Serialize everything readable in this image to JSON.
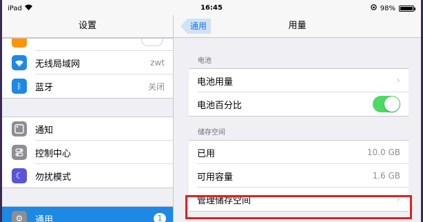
{
  "status_bar": {
    "device": "iPad",
    "time": "16:45",
    "battery": "98%",
    "battery_level": 0.98
  },
  "left": {
    "title": "设置",
    "group1": [
      {
        "label": "无线局域网",
        "detail": "zwt",
        "icon": "wifi-icon",
        "color": "#1e88e5"
      },
      {
        "label": "蓝牙",
        "detail": "关闭",
        "icon": "bluetooth-icon",
        "color": "#1e88e5"
      }
    ],
    "group2": [
      {
        "label": "通知",
        "icon": "notification-icon",
        "color": "#8e8e93"
      },
      {
        "label": "控制中心",
        "icon": "control-center-icon",
        "color": "#8e8e93"
      },
      {
        "label": "勿扰模式",
        "icon": "moon-icon",
        "color": "#5856d6"
      }
    ],
    "group3": [
      {
        "label": "通用",
        "badge": "1",
        "icon": "gear-icon",
        "color": "#8e8e93"
      }
    ]
  },
  "right": {
    "back_label": "通用",
    "title": "用量",
    "battery_section": "电池",
    "battery_rows": [
      {
        "label": "电池用量"
      },
      {
        "label": "电池百分比"
      }
    ],
    "storage_section": "储存空间",
    "storage_rows": [
      {
        "label": "已用",
        "value": "10.0 GB"
      },
      {
        "label": "可用容量",
        "value": "1.6 GB"
      },
      {
        "label": "管理储存空间"
      }
    ]
  }
}
